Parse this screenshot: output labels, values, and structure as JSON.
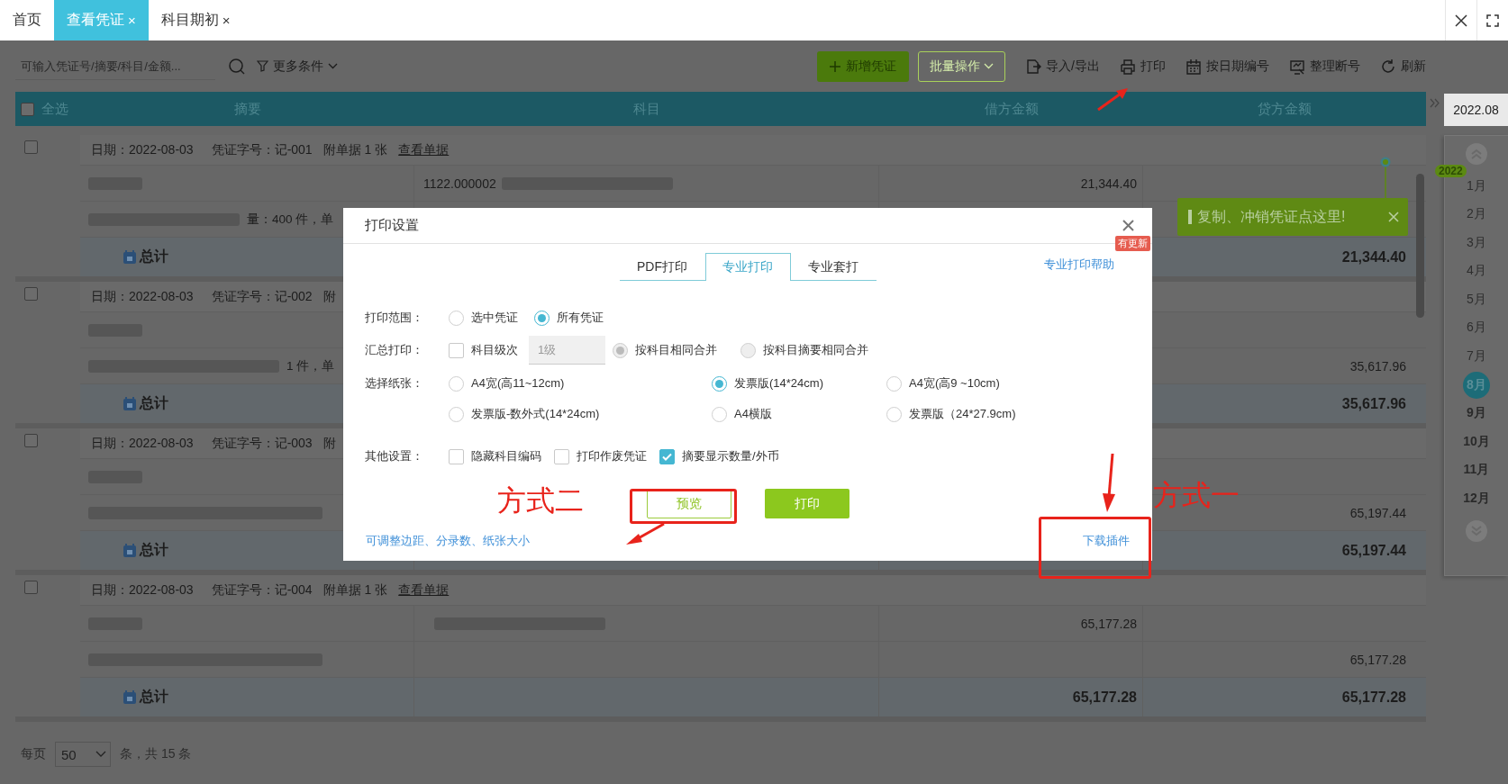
{
  "tabs": [
    {
      "label": "首页",
      "selected": false
    },
    {
      "label": "查看凭证",
      "close": "×",
      "selected": true
    },
    {
      "label": "科目期初",
      "close": "×",
      "selected": false
    }
  ],
  "toolbar": {
    "search_placeholder": "可输入凭证号/摘要/科目/金额...",
    "filter": "更多条件",
    "buttons": [
      {
        "label": "新增凭证",
        "kind": "primary"
      },
      {
        "label": "批量操作",
        "kind": "dropdown"
      },
      {
        "label": "导入/导出",
        "kind": "icon"
      },
      {
        "label": "打印",
        "kind": "icon"
      },
      {
        "label": "按日期编号",
        "kind": "icon"
      },
      {
        "label": "整理断号",
        "kind": "icon"
      },
      {
        "label": "刷新",
        "kind": "icon"
      }
    ]
  },
  "table": {
    "select_all_checked": false,
    "columns": [
      "全选",
      "摘要",
      "科目",
      "借方金额",
      "贷方金额"
    ],
    "groups": [
      {
        "checked": false,
        "date": "日期：2022-08-03",
        "voucher": "凭证字号：记-001",
        "attachments": "附单据 1 张",
        "view_link": "查看单据",
        "rows": [
          {
            "subject": "1122.000002",
            "subject_blurred": true,
            "debit": "21,344.40"
          },
          {
            "summary": "量：400 件，单"
          }
        ],
        "total_label": "总计",
        "total_credit": "21,344.40"
      },
      {
        "checked": false,
        "date": "日期：2022-08-03",
        "voucher": "凭证字号：记-002",
        "attachments": "附",
        "rows": [
          {},
          {
            "summary": "1 件，单",
            "credit": "35,617.96"
          }
        ],
        "total_label": "总计",
        "total_credit": "35,617.96"
      },
      {
        "checked": false,
        "date": "日期：2022-08-03",
        "voucher": "凭证字号：记-003",
        "attachments": "附",
        "rows": [
          {},
          {
            "credit": "65,197.44"
          }
        ],
        "total_label": "总计",
        "total_credit": "65,197.44"
      },
      {
        "checked": false,
        "date": "日期：2022-08-03",
        "voucher": "凭证字号：记-004",
        "attachments": "附单据 1 张",
        "view_link": "查看单据",
        "rows": [
          {
            "subject_blurred": true,
            "debit": "65,177.28"
          },
          {
            "credit": "65,177.28"
          }
        ],
        "total_label": "总计",
        "total_debit": "65,177.28",
        "total_credit": "65,177.28"
      }
    ]
  },
  "pagination": {
    "label": "每页",
    "page_size": "50",
    "summary": "条，共 15 条"
  },
  "sidebar": {
    "period": "2022.08",
    "year": "2022",
    "months": [
      {
        "label": "1月",
        "selected": false,
        "dimmed": true
      },
      {
        "label": "2月",
        "selected": false,
        "dimmed": true
      },
      {
        "label": "3月",
        "selected": false,
        "dimmed": true
      },
      {
        "label": "4月",
        "selected": false,
        "dimmed": true
      },
      {
        "label": "5月",
        "selected": false,
        "dimmed": true
      },
      {
        "label": "6月",
        "selected": false,
        "dimmed": true
      },
      {
        "label": "7月",
        "selected": false,
        "dimmed": true
      },
      {
        "label": "8月",
        "selected": true,
        "dimmed": false
      },
      {
        "label": "9月",
        "selected": false,
        "dimmed": false
      },
      {
        "label": "10月",
        "selected": false,
        "dimmed": false
      },
      {
        "label": "11月",
        "selected": false,
        "dimmed": false
      },
      {
        "label": "12月",
        "selected": false,
        "dimmed": false
      }
    ]
  },
  "toast": {
    "text": "复制、冲销凭证点这里!"
  },
  "dialog": {
    "title": "打印设置",
    "tabs": [
      {
        "label": "PDF打印",
        "selected": false
      },
      {
        "label": "专业打印",
        "selected": true
      },
      {
        "label": "专业套打",
        "selected": false
      }
    ],
    "help_link": "专业打印帮助",
    "badge": "有更新",
    "print_range": {
      "label": "打印范围：",
      "options": [
        {
          "label": "选中凭证",
          "selected": false
        },
        {
          "label": "所有凭证",
          "selected": true
        }
      ]
    },
    "summary_print": {
      "label": "汇总打印：",
      "level_checkbox": {
        "label": "科目级次",
        "checked": false
      },
      "level_select": {
        "value": "1级",
        "disabled": true
      },
      "merge_options": [
        {
          "label": "按科目相同合并",
          "selected": true,
          "disabled": true
        },
        {
          "label": "按科目摘要相同合并",
          "selected": false,
          "disabled": true
        }
      ]
    },
    "paper": {
      "label": "选择纸张：",
      "options": [
        {
          "label": "A4宽(高11~12cm)",
          "selected": false
        },
        {
          "label": "发票版(14*24cm)",
          "selected": true
        },
        {
          "label": "A4宽(高9 ~10cm)",
          "selected": false
        },
        {
          "label": "发票版-数外式(14*24cm)",
          "selected": false
        },
        {
          "label": "A4横版",
          "selected": false
        },
        {
          "label": "发票版（24*27.9cm)",
          "selected": false
        }
      ]
    },
    "other": {
      "label": "其他设置：",
      "options": [
        {
          "label": "隐藏科目编码",
          "checked": false
        },
        {
          "label": "打印作废凭证",
          "checked": false
        },
        {
          "label": "摘要显示数量/外币",
          "checked": true
        }
      ]
    },
    "buttons": [
      {
        "label": "预览",
        "kind": "secondary"
      },
      {
        "label": "打印",
        "kind": "primary"
      }
    ],
    "footer_link": "可调整边距、分录数、纸张大小",
    "download_link": "下载插件"
  },
  "annotations": [
    {
      "text": "方式二"
    },
    {
      "text": "方式一"
    }
  ]
}
